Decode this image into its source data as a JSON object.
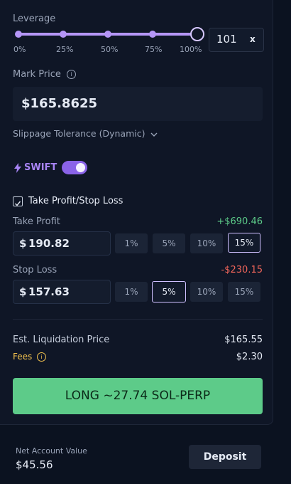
{
  "leverage": {
    "label": "Leverage",
    "ticks": [
      "0%",
      "25%",
      "50%",
      "75%",
      "100%"
    ],
    "value": "101",
    "multiplier_symbol": "x",
    "slider_level_percent": 100
  },
  "mark_price": {
    "label": "Mark Price",
    "info_symbol": "i",
    "value": "$165.8625"
  },
  "slippage": {
    "label": "Slippage Tolerance (Dynamic)",
    "chevron": "chevron-down-icon"
  },
  "swift": {
    "label": "SWIFT",
    "enabled": true,
    "icon": "lightning-icon"
  },
  "tpsl": {
    "checkbox_label": "Take Profit/Stop Loss",
    "checked": true,
    "take_profit": {
      "label": "Take Profit",
      "pnl": "+$690.46",
      "currency": "$",
      "value": "190.82",
      "options": [
        "1%",
        "5%",
        "10%",
        "15%"
      ],
      "selected": "15%"
    },
    "stop_loss": {
      "label": "Stop Loss",
      "pnl": "-$230.15",
      "currency": "$",
      "value": "157.63",
      "options": [
        "1%",
        "5%",
        "10%",
        "15%"
      ],
      "selected": "5%"
    }
  },
  "summary": {
    "liq_label": "Est. Liquidation Price",
    "liq_value": "$165.55",
    "fees_label": "Fees",
    "fees_info_symbol": "i",
    "fees_value": "$2.30"
  },
  "action": {
    "long_label": "LONG ~27.74 SOL-PERP"
  },
  "account": {
    "nav_label": "Net Account Value",
    "nav_value": "$45.56",
    "deposit_label": "Deposit"
  },
  "colors": {
    "accent_purple": "#b596f7",
    "profit_green": "#5dcb89",
    "loss_red": "#f0655a",
    "fees_yellow": "#f2c14e"
  }
}
